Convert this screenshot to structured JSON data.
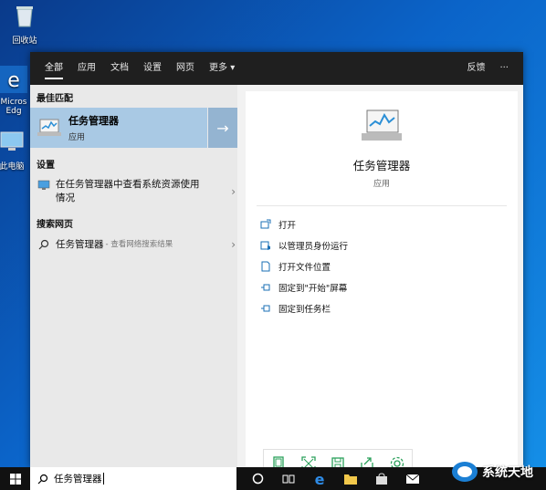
{
  "desktop": {
    "icons": [
      {
        "label": "回收站",
        "icon": "recycle-bin-icon"
      },
      {
        "label": "Micros\nEdg",
        "icon": "edge-icon"
      },
      {
        "label": "此电脑",
        "icon": "computer-icon"
      }
    ]
  },
  "topbar": {
    "tabs": [
      "全部",
      "应用",
      "文档",
      "设置",
      "网页",
      "更多"
    ],
    "more_arrow": "▾",
    "feedback": "反馈",
    "menu": "···"
  },
  "left": {
    "best_match_header": "最佳匹配",
    "best_match": {
      "title": "任务管理器",
      "subtitle": "应用",
      "arrow": "→"
    },
    "settings_header": "设置",
    "settings_item": {
      "text": "在任务管理器中查看系统资源使用情况",
      "chevron": "›"
    },
    "web_header": "搜索网页",
    "web_item": {
      "text": "任务管理器",
      "sub": " - 查看网络搜索结果",
      "chevron": "›"
    }
  },
  "right": {
    "title": "任务管理器",
    "type": "应用",
    "actions": [
      {
        "label": "打开",
        "icon": "open-icon"
      },
      {
        "label": "以管理员身份运行",
        "icon": "shield-icon"
      },
      {
        "label": "打开文件位置",
        "icon": "folder-icon"
      },
      {
        "label": "固定到\"开始\"屏幕",
        "icon": "pin-icon"
      },
      {
        "label": "固定到任务栏",
        "icon": "pin-icon"
      }
    ]
  },
  "taskbar": {
    "search_value": "任务管理器",
    "icons": [
      "cortana-icon",
      "task-view-icon",
      "edge-icon",
      "file-explorer-icon",
      "store-icon",
      "mail-icon"
    ]
  },
  "watermark": {
    "text": "系统天地"
  },
  "colors": {
    "accent": "#1a6fb5",
    "selection": "#a9c9e4",
    "topbar": "#1f1f1f",
    "taskbar": "#111111"
  }
}
